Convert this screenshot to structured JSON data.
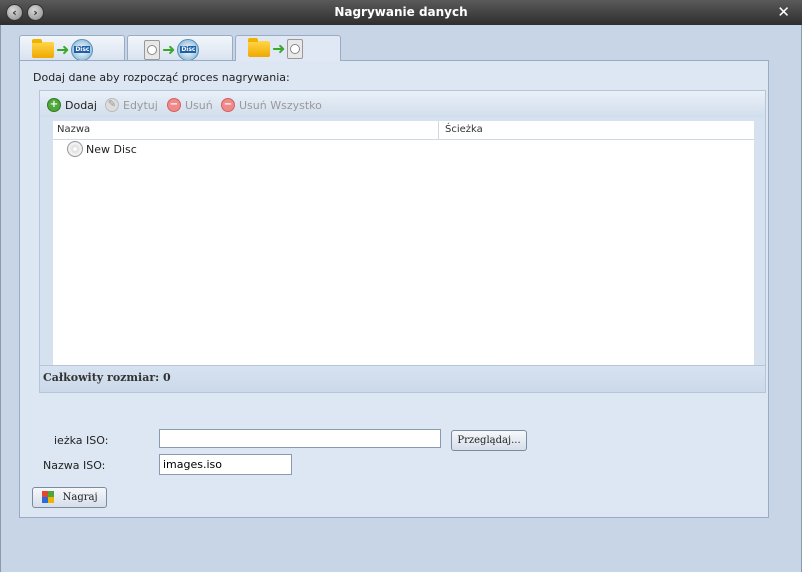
{
  "window": {
    "title": "Nagrywanie danych"
  },
  "tabs": [
    {
      "name": "data-to-disc"
    },
    {
      "name": "image-to-disc"
    },
    {
      "name": "data-to-image"
    }
  ],
  "panel": {
    "instruction": "Dodaj dane aby rozpocząć proces nagrywania:"
  },
  "toolbar": {
    "add_label": "Dodaj",
    "edit_label": "Edytuj",
    "remove_label": "Usuń",
    "remove_all_label": "Usuń Wszystko"
  },
  "table": {
    "columns": [
      "Nazwa",
      "Ścieżka"
    ],
    "rows": [
      {
        "name": "New Disc",
        "path": ""
      }
    ]
  },
  "footer": {
    "total_size": "Całkowity rozmiar: 0"
  },
  "iso": {
    "path_label": "ieżka ISO:",
    "path_value": "",
    "browse_label": "Przeglądaj...",
    "name_label": "Nazwa ISO:",
    "name_value": "images.iso"
  },
  "actions": {
    "burn_label": "Nagraj"
  },
  "icons": {
    "back": "back-icon",
    "forward": "forward-icon",
    "close": "close-icon",
    "add": "add-icon",
    "edit": "edit-icon",
    "remove": "remove-icon",
    "disc": "disc-icon",
    "burn": "burn-icon"
  }
}
